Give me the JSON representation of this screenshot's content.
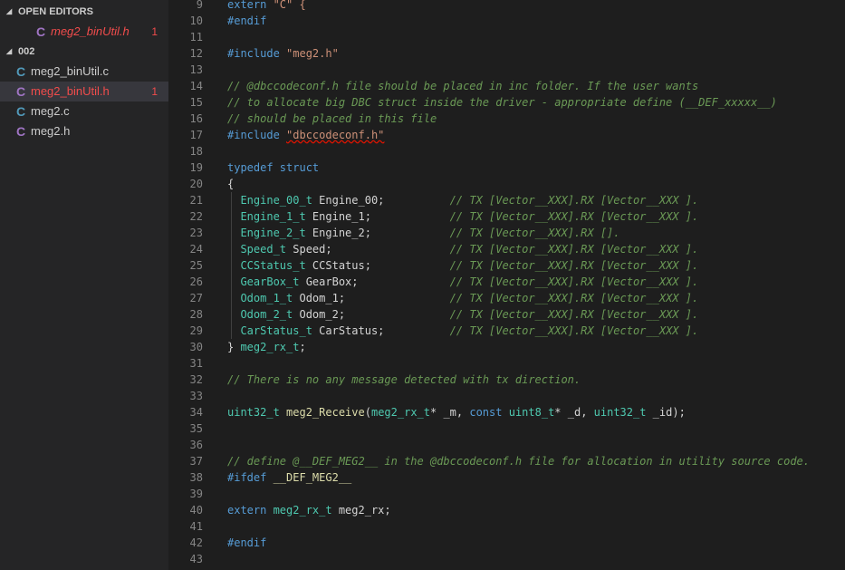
{
  "sidebar": {
    "open_editors": {
      "title": "OPEN EDITORS",
      "items": [
        {
          "icon": "C",
          "name": "meg2_binUtil.h",
          "badge": "1"
        }
      ]
    },
    "folder": {
      "title": "002",
      "items": [
        {
          "icon": "C",
          "name": "meg2_binUtil.c",
          "badge": ""
        },
        {
          "icon": "C",
          "name": "meg2_binUtil.h",
          "badge": "1"
        },
        {
          "icon": "C",
          "name": "meg2.c",
          "badge": ""
        },
        {
          "icon": "C",
          "name": "meg2.h",
          "badge": ""
        }
      ]
    }
  },
  "editor": {
    "lines": [
      {
        "n": "9",
        "tokens": [
          {
            "t": "extern ",
            "c": "tk-kw"
          },
          {
            "t": "\"C\" {",
            "c": "tk-str"
          }
        ]
      },
      {
        "n": "10",
        "tokens": [
          {
            "t": "#endif",
            "c": "tk-kw"
          }
        ]
      },
      {
        "n": "11",
        "tokens": []
      },
      {
        "n": "12",
        "tokens": [
          {
            "t": "#include ",
            "c": "tk-kw"
          },
          {
            "t": "\"meg2.h\"",
            "c": "tk-str"
          }
        ]
      },
      {
        "n": "13",
        "tokens": []
      },
      {
        "n": "14",
        "tokens": [
          {
            "t": "// @dbccodeconf.h file should be placed in inc folder. If the user wants",
            "c": "tk-cmt"
          }
        ]
      },
      {
        "n": "15",
        "tokens": [
          {
            "t": "// to allocate big DBC struct inside the driver - appropriate define (__DEF_xxxxx__)",
            "c": "tk-cmt"
          }
        ]
      },
      {
        "n": "16",
        "tokens": [
          {
            "t": "// should be placed in this file",
            "c": "tk-cmt"
          }
        ]
      },
      {
        "n": "17",
        "tokens": [
          {
            "t": "#include ",
            "c": "tk-kw"
          },
          {
            "t": "\"dbccodeconf.h\"",
            "c": "tk-str-wave"
          }
        ]
      },
      {
        "n": "18",
        "tokens": []
      },
      {
        "n": "19",
        "tokens": [
          {
            "t": "typedef ",
            "c": "tk-kw"
          },
          {
            "t": "struct",
            "c": "tk-kw"
          }
        ]
      },
      {
        "n": "20",
        "tokens": [
          {
            "t": "{",
            "c": "tk-plain"
          }
        ]
      },
      {
        "n": "21",
        "tokens": [
          {
            "t": "  ",
            "c": "tk-plain"
          },
          {
            "t": "Engine_00_t",
            "c": "tk-type"
          },
          {
            "t": " Engine_00;          ",
            "c": "tk-plain"
          },
          {
            "t": "// TX [Vector__XXX].RX [Vector__XXX ].",
            "c": "tk-cmt"
          }
        ]
      },
      {
        "n": "22",
        "tokens": [
          {
            "t": "  ",
            "c": "tk-plain"
          },
          {
            "t": "Engine_1_t",
            "c": "tk-type"
          },
          {
            "t": " Engine_1;            ",
            "c": "tk-plain"
          },
          {
            "t": "// TX [Vector__XXX].RX [Vector__XXX ].",
            "c": "tk-cmt"
          }
        ]
      },
      {
        "n": "23",
        "tokens": [
          {
            "t": "  ",
            "c": "tk-plain"
          },
          {
            "t": "Engine_2_t",
            "c": "tk-type"
          },
          {
            "t": " Engine_2;            ",
            "c": "tk-plain"
          },
          {
            "t": "// TX [Vector__XXX].RX [].",
            "c": "tk-cmt"
          }
        ]
      },
      {
        "n": "24",
        "tokens": [
          {
            "t": "  ",
            "c": "tk-plain"
          },
          {
            "t": "Speed_t",
            "c": "tk-type"
          },
          {
            "t": " Speed;                  ",
            "c": "tk-plain"
          },
          {
            "t": "// TX [Vector__XXX].RX [Vector__XXX ].",
            "c": "tk-cmt"
          }
        ]
      },
      {
        "n": "25",
        "tokens": [
          {
            "t": "  ",
            "c": "tk-plain"
          },
          {
            "t": "CCStatus_t",
            "c": "tk-type"
          },
          {
            "t": " CCStatus;            ",
            "c": "tk-plain"
          },
          {
            "t": "// TX [Vector__XXX].RX [Vector__XXX ].",
            "c": "tk-cmt"
          }
        ]
      },
      {
        "n": "26",
        "tokens": [
          {
            "t": "  ",
            "c": "tk-plain"
          },
          {
            "t": "GearBox_t",
            "c": "tk-type"
          },
          {
            "t": " GearBox;              ",
            "c": "tk-plain"
          },
          {
            "t": "// TX [Vector__XXX].RX [Vector__XXX ].",
            "c": "tk-cmt"
          }
        ]
      },
      {
        "n": "27",
        "tokens": [
          {
            "t": "  ",
            "c": "tk-plain"
          },
          {
            "t": "Odom_1_t",
            "c": "tk-type"
          },
          {
            "t": " Odom_1;                ",
            "c": "tk-plain"
          },
          {
            "t": "// TX [Vector__XXX].RX [Vector__XXX ].",
            "c": "tk-cmt"
          }
        ]
      },
      {
        "n": "28",
        "tokens": [
          {
            "t": "  ",
            "c": "tk-plain"
          },
          {
            "t": "Odom_2_t",
            "c": "tk-type"
          },
          {
            "t": " Odom_2;                ",
            "c": "tk-plain"
          },
          {
            "t": "// TX [Vector__XXX].RX [Vector__XXX ].",
            "c": "tk-cmt"
          }
        ]
      },
      {
        "n": "29",
        "tokens": [
          {
            "t": "  ",
            "c": "tk-plain"
          },
          {
            "t": "CarStatus_t",
            "c": "tk-type"
          },
          {
            "t": " CarStatus;          ",
            "c": "tk-plain"
          },
          {
            "t": "// TX [Vector__XXX].RX [Vector__XXX ].",
            "c": "tk-cmt"
          }
        ]
      },
      {
        "n": "30",
        "tokens": [
          {
            "t": "} ",
            "c": "tk-plain"
          },
          {
            "t": "meg2_rx_t",
            "c": "tk-type"
          },
          {
            "t": ";",
            "c": "tk-plain"
          }
        ]
      },
      {
        "n": "31",
        "tokens": []
      },
      {
        "n": "32",
        "tokens": [
          {
            "t": "// There is no any message detected with tx direction.",
            "c": "tk-cmt"
          }
        ]
      },
      {
        "n": "33",
        "tokens": []
      },
      {
        "n": "34",
        "tokens": [
          {
            "t": "uint32_t",
            "c": "tk-type"
          },
          {
            "t": " ",
            "c": "tk-plain"
          },
          {
            "t": "meg2_Receive",
            "c": "tk-fn"
          },
          {
            "t": "(",
            "c": "tk-plain"
          },
          {
            "t": "meg2_rx_t",
            "c": "tk-type"
          },
          {
            "t": "* _m, ",
            "c": "tk-plain"
          },
          {
            "t": "const",
            "c": "tk-kw"
          },
          {
            "t": " ",
            "c": "tk-plain"
          },
          {
            "t": "uint8_t",
            "c": "tk-type"
          },
          {
            "t": "* _d, ",
            "c": "tk-plain"
          },
          {
            "t": "uint32_t",
            "c": "tk-type"
          },
          {
            "t": " _id);",
            "c": "tk-plain"
          }
        ]
      },
      {
        "n": "35",
        "tokens": []
      },
      {
        "n": "36",
        "tokens": []
      },
      {
        "n": "37",
        "tokens": [
          {
            "t": "// define @__DEF_MEG2__ in the @dbccodeconf.h file for allocation in utility source code.",
            "c": "tk-cmt"
          }
        ]
      },
      {
        "n": "38",
        "tokens": [
          {
            "t": "#ifdef ",
            "c": "tk-kw"
          },
          {
            "t": "__DEF_MEG2__",
            "c": "tk-fn"
          }
        ]
      },
      {
        "n": "39",
        "tokens": []
      },
      {
        "n": "40",
        "tokens": [
          {
            "t": "extern ",
            "c": "tk-kw"
          },
          {
            "t": "meg2_rx_t",
            "c": "tk-type"
          },
          {
            "t": " meg2_rx;",
            "c": "tk-plain"
          }
        ]
      },
      {
        "n": "41",
        "tokens": []
      },
      {
        "n": "42",
        "tokens": [
          {
            "t": "#endif",
            "c": "tk-kw"
          }
        ]
      },
      {
        "n": "43",
        "tokens": []
      }
    ]
  }
}
